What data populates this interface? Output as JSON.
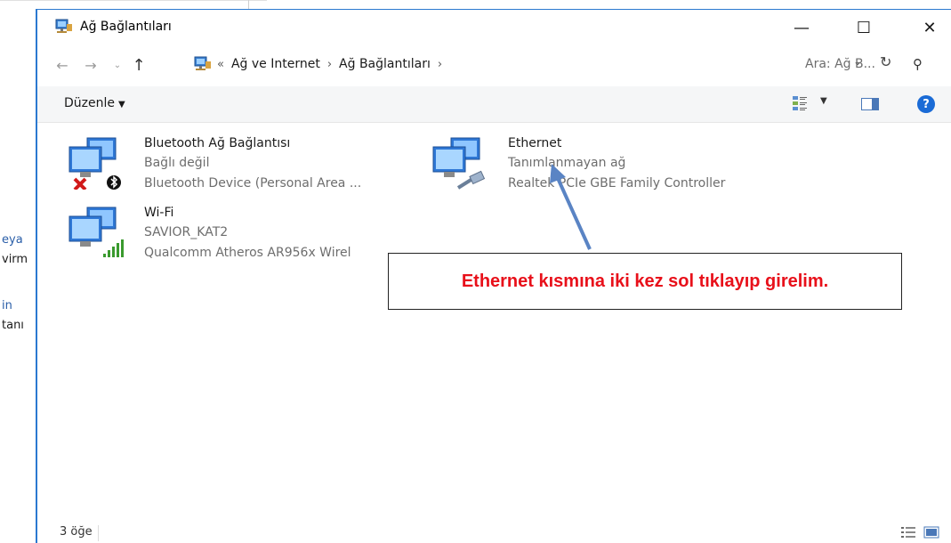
{
  "background_window": {
    "fragments": [
      "eya",
      "virm",
      "in",
      "tanı"
    ]
  },
  "window": {
    "title": "Ağ Bağlantıları",
    "controls": {
      "minimize": "—",
      "maximize": "☐",
      "close": "✕"
    }
  },
  "address_bar": {
    "overflow": "«",
    "breadcrumbs": [
      "Ağ ve Internet",
      "Ağ Bağlantıları"
    ],
    "separator": "›",
    "search_placeholder": "Ara: Ağ B..."
  },
  "command_bar": {
    "organize_label": "Düzenle"
  },
  "items": [
    {
      "name": "Bluetooth Ağ Bağlantısı",
      "status": "Bağlı değil",
      "device": "Bluetooth Device (Personal Area ...",
      "icon": "bluetooth-network-icon"
    },
    {
      "name": "Ethernet",
      "status": "Tanımlanmayan ağ",
      "device": "Realtek PCIe GBE Family Controller",
      "icon": "ethernet-network-icon"
    },
    {
      "name": "Wi-Fi",
      "status": "SAVIOR_KAT2",
      "device": "Qualcomm Atheros AR956x Wirel",
      "icon": "wifi-network-icon"
    }
  ],
  "status_bar": {
    "item_count": "3 öğe"
  },
  "annotation": {
    "text": "Ethernet kısmına iki kez sol tıklayıp girelim."
  },
  "colors": {
    "accent": "#2b79d0",
    "annotation_text": "#e8101a",
    "arrow": "#5a84c4",
    "secondary_text": "#6d6d6d"
  }
}
